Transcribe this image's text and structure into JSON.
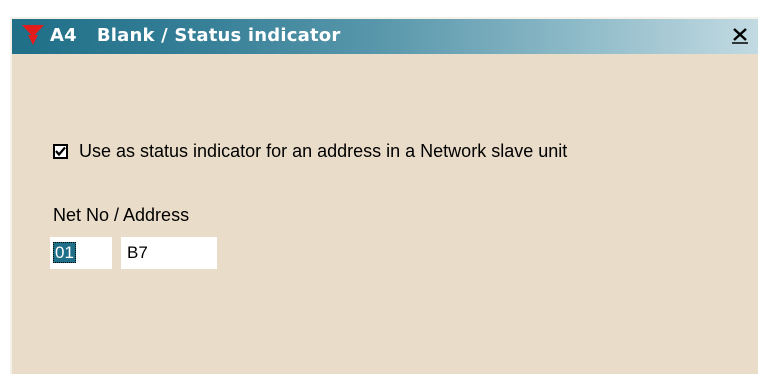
{
  "window": {
    "code": "A4",
    "title": "Blank / Status indicator",
    "close_label": "X"
  },
  "status_indicator": {
    "label": "Use as status indicator for an address in a Network slave unit",
    "checked": true
  },
  "net_address": {
    "label": "Net No / Address",
    "net_no": "01",
    "address": "B7"
  },
  "colors": {
    "titlebar_start": "#1f6f88",
    "titlebar_end": "#c2dae2",
    "background": "#e9dcc8",
    "logo_red": "#e21b1b",
    "selection": "#1f6f88"
  },
  "icons": {
    "logo": "red-triangle-logo-icon",
    "close": "close-icon",
    "check": "checkmark-icon"
  }
}
